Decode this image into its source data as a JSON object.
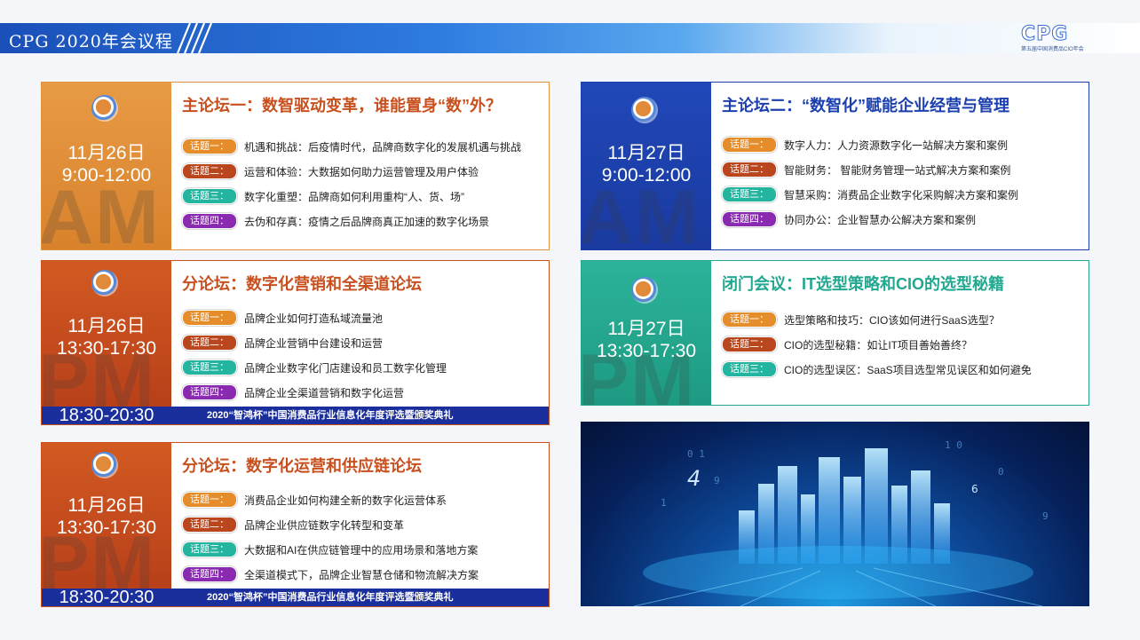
{
  "header": {
    "title": "CPG 2020年会议程"
  },
  "logo": {
    "mark": "CPG",
    "subtitle": "第五届中国消费品CIO年会"
  },
  "colors": {
    "orange": "#e08a3a",
    "rust": "#c8501f",
    "blue": "#1b3fae",
    "teal": "#22a890",
    "navy": "#1b2f9c"
  },
  "sessions": [
    {
      "id": "am1",
      "watermark": "AM",
      "date": "11月26日",
      "time": "9:00-12:00",
      "title": "主论坛一：数智驱动变革，谁能置身“数”外？",
      "topics": [
        {
          "badge": "话题一：",
          "text": "机遇和挑战：后疫情时代，品牌商数字化的发展机遇与挑战"
        },
        {
          "badge": "话题二：",
          "text": "运营和体验：大数据如何助力运营管理及用户体验"
        },
        {
          "badge": "话题三：",
          "text": "数字化重塑：品牌商如何利用重构“人、货、场”"
        },
        {
          "badge": "话题四：",
          "text": "去伪和存真：疫情之后品牌商真正加速的数字化场景"
        }
      ]
    },
    {
      "id": "pm1",
      "watermark": "PM",
      "date": "11月26日",
      "time": "13:30-17:30",
      "title": "分论坛：数字化营销和全渠道论坛",
      "topics": [
        {
          "badge": "话题一：",
          "text": "品牌企业如何打造私域流量池"
        },
        {
          "badge": "话题二：",
          "text": "品牌企业营销中台建设和运营"
        },
        {
          "badge": "话题三：",
          "text": "品牌企业数字化门店建设和员工数字化管理"
        },
        {
          "badge": "话题四：",
          "text": "品牌企业全渠道营销和数字化运营"
        }
      ],
      "footer_time": "18:30-20:30",
      "footer_event": "2020“智鸿杯”中国消费品行业信息化年度评选暨颁奖典礼"
    },
    {
      "id": "pm2",
      "watermark": "PM",
      "date": "11月26日",
      "time": "13:30-17:30",
      "title": "分论坛：数字化运营和供应链论坛",
      "topics": [
        {
          "badge": "话题一：",
          "text": "消费品企业如何构建全新的数字化运营体系"
        },
        {
          "badge": "话题二：",
          "text": "品牌企业供应链数字化转型和变革"
        },
        {
          "badge": "话题三：",
          "text": "大数据和AI在供应链管理中的应用场景和落地方案"
        },
        {
          "badge": "话题四：",
          "text": "全渠道模式下，品牌企业智慧仓储和物流解决方案"
        }
      ],
      "footer_time": "18:30-20:30",
      "footer_event": "2020“智鸿杯”中国消费品行业信息化年度评选暨颁奖典礼"
    },
    {
      "id": "am2",
      "watermark": "AM",
      "date": "11月27日",
      "time": "9:00-12:00",
      "title": "主论坛二：“数智化”赋能企业经营与管理",
      "topics": [
        {
          "badge": "话题一：",
          "text": "数字人力：人力资源数字化一站解决方案和案例"
        },
        {
          "badge": "话题二：",
          "text": "智能财务：  智能财务管理一站式解决方案和案例"
        },
        {
          "badge": "话题三：",
          "text": "智慧采购：消费品企业数字化采购解决方案和案例"
        },
        {
          "badge": "话题四：",
          "text": "协同办公：企业智慧办公解决方案和案例"
        }
      ]
    },
    {
      "id": "pm3",
      "watermark": "PM",
      "date": "11月27日",
      "time": "13:30-17:30",
      "title": "闭门会议：IT选型策略和CIO的选型秘籍",
      "topics": [
        {
          "badge": "话题一：",
          "text": "选型策略和技巧：CIO该如何进行SaaS选型？"
        },
        {
          "badge": "话题二：",
          "text": "CIO的选型秘籍：如让IT项目善始善终？"
        },
        {
          "badge": "话题三：",
          "text": "CIO的选型误区：SaaS项目选型常见误区和如何避免"
        }
      ]
    }
  ],
  "city_image": {
    "digit_a": "4",
    "digit_b": "6"
  }
}
